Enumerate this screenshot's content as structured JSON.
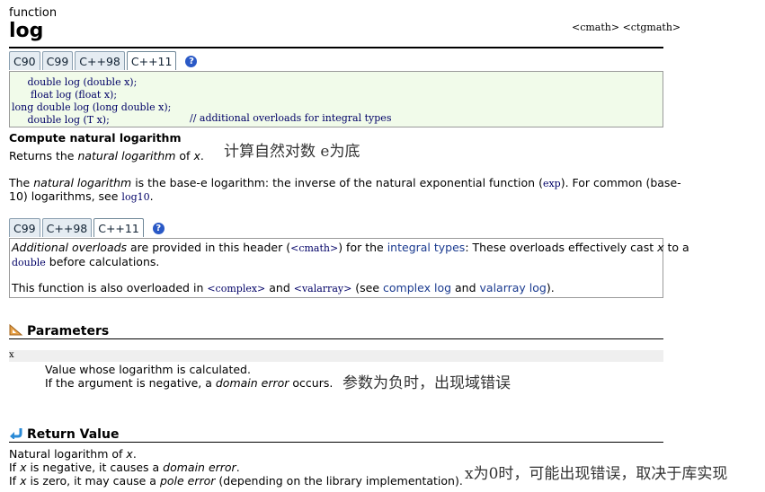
{
  "header": {
    "kind": "function",
    "title": "log",
    "headers": "<cmath> <ctgmath>"
  },
  "std_tabs_1": [
    "C90",
    "C99",
    "C++98",
    "C++11"
  ],
  "std_tabs_1_active": 3,
  "help_glyph": "?",
  "prototypes": [
    {
      "text": "     double log (double x);",
      "comment": ""
    },
    {
      "text": "      float log (float x);",
      "comment": ""
    },
    {
      "text": "long double log (long double x);",
      "comment": ""
    },
    {
      "text": "     double log (T x);",
      "comment": "// additional overloads for integral types"
    }
  ],
  "summary": {
    "heading": "Compute natural logarithm",
    "returns_prefix": "Returns the ",
    "returns_em": "natural logarithm",
    "returns_mid": " of ",
    "returns_x": "x",
    "returns_end": "."
  },
  "annotations": {
    "natural_log": "计算自然对数  e为底",
    "negative_arg": "参数为负时，出现域错误",
    "zero_arg": "x为0时，可能出现错误，取决于库实现"
  },
  "description": {
    "p1": "The ",
    "p1_em": "natural logarithm",
    "p1_b": " is the base-e logarithm: the inverse of the natural exponential function (",
    "p1_code": "exp",
    "p1_c": "). For common (base-",
    "p2": "10) logarithms, see ",
    "p2_code": "log10",
    "p2_end": "."
  },
  "std_tabs_2": [
    "C99",
    "C++98",
    "C++11"
  ],
  "std_tabs_2_active": 2,
  "overloads": {
    "em": "Additional overloads",
    "a": " are provided in this header (",
    "code1": "<cmath>",
    "b": ") for the ",
    "link_integral": "integral types",
    "c": ": These overloads effectively cast ",
    "x": "x",
    "d": " to a",
    "code2": "double",
    "e": " before calculations.",
    "f": "This function is also overloaded in ",
    "code3": "<complex>",
    "g": " and ",
    "code4": "<valarray>",
    "h": " (see ",
    "link_complex": "complex log",
    "i": " and ",
    "link_valarray": "valarray log",
    "j": ")."
  },
  "parameters": {
    "heading": "Parameters",
    "name": "x",
    "desc1": "Value whose logarithm is calculated.",
    "desc2a": "If the argument is negative, a ",
    "desc2em": "domain error",
    "desc2b": " occurs."
  },
  "return_value": {
    "heading": "Return Value",
    "l1a": "Natural logarithm of ",
    "l1x": "x",
    "l1b": ".",
    "l2a": "If ",
    "l2x": "x",
    "l2b": " is negative, it causes a ",
    "l2em": "domain error",
    "l2c": ".",
    "l3a": "If ",
    "l3x": "x",
    "l3b": " is zero, it may cause a ",
    "l3em": "pole error",
    "l3c": " (depending on the library implementation)."
  }
}
